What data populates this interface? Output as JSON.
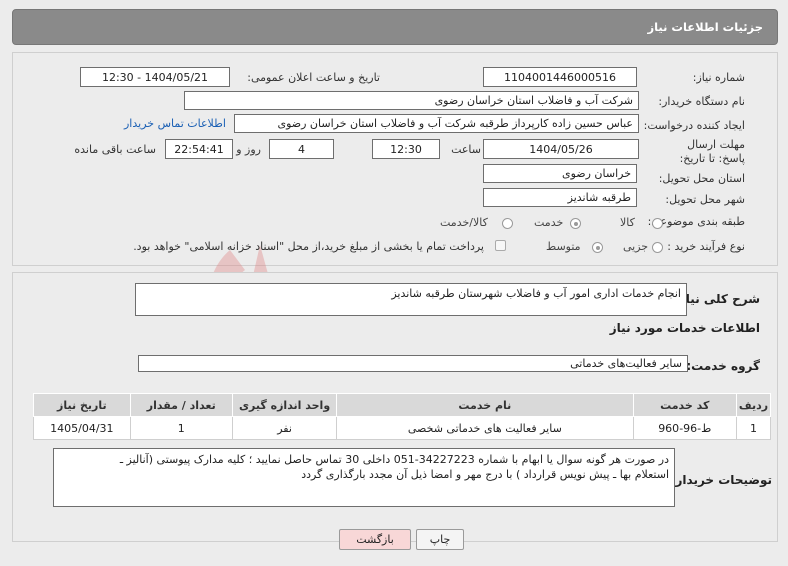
{
  "header": {
    "title": "جزئیات اطلاعات نیاز"
  },
  "form": {
    "need_number_label": "شماره نیاز:",
    "need_number": "1104001446000516",
    "announce_label": "تاریخ و ساعت اعلان عمومی:",
    "announce_value": "1404/05/21 - 12:30",
    "buyer_org_label": "نام دستگاه خریدار:",
    "buyer_org": "شرکت آب و فاضلاب استان خراسان رضوی",
    "creator_label": "ایجاد کننده درخواست:",
    "creator": "عباس حسین زاده کارپرداز طرقبه  شرکت آب و فاضلاب استان خراسان رضوی",
    "contact_link": "اطلاعات تماس خریدار",
    "deadline_label": "مهلت ارسال پاسخ: تا تاریخ:",
    "deadline_date": "1404/05/26",
    "time_label": "ساعت",
    "deadline_time": "12:30",
    "days_value": "4",
    "days_label": "روز و",
    "remaining_time": "22:54:41",
    "remaining_label": "ساعت باقی مانده",
    "province_label": "استان محل تحویل:",
    "province": "خراسان رضوی",
    "city_label": "شهر محل تحویل:",
    "city": "طرقبه شاندیز",
    "category_label": "طبقه بندی موضوعی:",
    "category_options": [
      "کالا",
      "خدمت",
      "کالا/خدمت"
    ],
    "category_selected": "خدمت",
    "process_label": "نوع فرآیند خرید :",
    "process_options": [
      "جزیی",
      "متوسط"
    ],
    "process_selected": "متوسط",
    "treasury_note": "پرداخت تمام یا بخشی از مبلغ خرید،از محل \"اسناد خزانه اسلامی\" خواهد بود."
  },
  "summary": {
    "label": "شرح کلی نیاز:",
    "text": "انجام خدمات اداری امور آب و فاضلاب شهرستان طرقبه شاندیز"
  },
  "services": {
    "section_title": "اطلاعات خدمات مورد نیاز",
    "group_label": "گروه خدمت:",
    "group_value": "سایر فعالیت‌های خدماتی",
    "columns": [
      "ردیف",
      "کد خدمت",
      "نام خدمت",
      "واحد اندازه گیری",
      "تعداد / مقدار",
      "تاریخ نیاز"
    ],
    "rows": [
      {
        "row": "1",
        "code": "ط-96-960",
        "name": "سایر فعالیت های خدماتی شخصی",
        "unit": "نفر",
        "qty": "1",
        "date": "1405/04/31"
      }
    ]
  },
  "buyer_notes": {
    "label": "توضیحات خریدار:",
    "line1": "در صورت هر گونه سوال یا ابهام با شماره 34227223-051 داخلی  30  تماس حاصل نمایید ؛ کلیه مدارک پیوستی (آنالیز ـ",
    "line2": "استعلام بها ـ پیش نویس قرارداد ) با درج مهر و امضا ذیل آن مجدد بارگذاری گردد"
  },
  "buttons": {
    "print": "چاپ",
    "back": "بازگشت"
  },
  "watermark": {
    "text": "AriaTender.neT"
  },
  "colors": {
    "title_bg": "#8a8a8a",
    "link": "#1a5fb4",
    "back_bg": "#f8d7d7",
    "watermark": "#e8b4b4"
  }
}
